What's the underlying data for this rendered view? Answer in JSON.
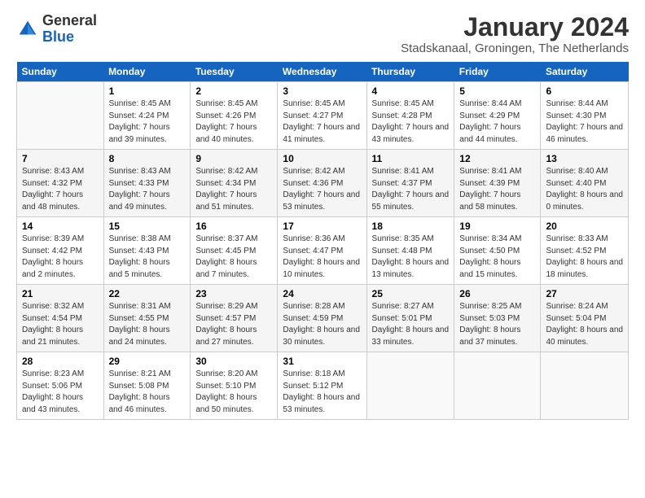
{
  "header": {
    "logo_general": "General",
    "logo_blue": "Blue",
    "month_title": "January 2024",
    "location": "Stadskanaal, Groningen, The Netherlands"
  },
  "days_of_week": [
    "Sunday",
    "Monday",
    "Tuesday",
    "Wednesday",
    "Thursday",
    "Friday",
    "Saturday"
  ],
  "weeks": [
    [
      {
        "day": "",
        "sunrise": "",
        "sunset": "",
        "daylight": ""
      },
      {
        "day": "1",
        "sunrise": "Sunrise: 8:45 AM",
        "sunset": "Sunset: 4:24 PM",
        "daylight": "Daylight: 7 hours and 39 minutes."
      },
      {
        "day": "2",
        "sunrise": "Sunrise: 8:45 AM",
        "sunset": "Sunset: 4:26 PM",
        "daylight": "Daylight: 7 hours and 40 minutes."
      },
      {
        "day": "3",
        "sunrise": "Sunrise: 8:45 AM",
        "sunset": "Sunset: 4:27 PM",
        "daylight": "Daylight: 7 hours and 41 minutes."
      },
      {
        "day": "4",
        "sunrise": "Sunrise: 8:45 AM",
        "sunset": "Sunset: 4:28 PM",
        "daylight": "Daylight: 7 hours and 43 minutes."
      },
      {
        "day": "5",
        "sunrise": "Sunrise: 8:44 AM",
        "sunset": "Sunset: 4:29 PM",
        "daylight": "Daylight: 7 hours and 44 minutes."
      },
      {
        "day": "6",
        "sunrise": "Sunrise: 8:44 AM",
        "sunset": "Sunset: 4:30 PM",
        "daylight": "Daylight: 7 hours and 46 minutes."
      }
    ],
    [
      {
        "day": "7",
        "sunrise": "Sunrise: 8:43 AM",
        "sunset": "Sunset: 4:32 PM",
        "daylight": "Daylight: 7 hours and 48 minutes."
      },
      {
        "day": "8",
        "sunrise": "Sunrise: 8:43 AM",
        "sunset": "Sunset: 4:33 PM",
        "daylight": "Daylight: 7 hours and 49 minutes."
      },
      {
        "day": "9",
        "sunrise": "Sunrise: 8:42 AM",
        "sunset": "Sunset: 4:34 PM",
        "daylight": "Daylight: 7 hours and 51 minutes."
      },
      {
        "day": "10",
        "sunrise": "Sunrise: 8:42 AM",
        "sunset": "Sunset: 4:36 PM",
        "daylight": "Daylight: 7 hours and 53 minutes."
      },
      {
        "day": "11",
        "sunrise": "Sunrise: 8:41 AM",
        "sunset": "Sunset: 4:37 PM",
        "daylight": "Daylight: 7 hours and 55 minutes."
      },
      {
        "day": "12",
        "sunrise": "Sunrise: 8:41 AM",
        "sunset": "Sunset: 4:39 PM",
        "daylight": "Daylight: 7 hours and 58 minutes."
      },
      {
        "day": "13",
        "sunrise": "Sunrise: 8:40 AM",
        "sunset": "Sunset: 4:40 PM",
        "daylight": "Daylight: 8 hours and 0 minutes."
      }
    ],
    [
      {
        "day": "14",
        "sunrise": "Sunrise: 8:39 AM",
        "sunset": "Sunset: 4:42 PM",
        "daylight": "Daylight: 8 hours and 2 minutes."
      },
      {
        "day": "15",
        "sunrise": "Sunrise: 8:38 AM",
        "sunset": "Sunset: 4:43 PM",
        "daylight": "Daylight: 8 hours and 5 minutes."
      },
      {
        "day": "16",
        "sunrise": "Sunrise: 8:37 AM",
        "sunset": "Sunset: 4:45 PM",
        "daylight": "Daylight: 8 hours and 7 minutes."
      },
      {
        "day": "17",
        "sunrise": "Sunrise: 8:36 AM",
        "sunset": "Sunset: 4:47 PM",
        "daylight": "Daylight: 8 hours and 10 minutes."
      },
      {
        "day": "18",
        "sunrise": "Sunrise: 8:35 AM",
        "sunset": "Sunset: 4:48 PM",
        "daylight": "Daylight: 8 hours and 13 minutes."
      },
      {
        "day": "19",
        "sunrise": "Sunrise: 8:34 AM",
        "sunset": "Sunset: 4:50 PM",
        "daylight": "Daylight: 8 hours and 15 minutes."
      },
      {
        "day": "20",
        "sunrise": "Sunrise: 8:33 AM",
        "sunset": "Sunset: 4:52 PM",
        "daylight": "Daylight: 8 hours and 18 minutes."
      }
    ],
    [
      {
        "day": "21",
        "sunrise": "Sunrise: 8:32 AM",
        "sunset": "Sunset: 4:54 PM",
        "daylight": "Daylight: 8 hours and 21 minutes."
      },
      {
        "day": "22",
        "sunrise": "Sunrise: 8:31 AM",
        "sunset": "Sunset: 4:55 PM",
        "daylight": "Daylight: 8 hours and 24 minutes."
      },
      {
        "day": "23",
        "sunrise": "Sunrise: 8:29 AM",
        "sunset": "Sunset: 4:57 PM",
        "daylight": "Daylight: 8 hours and 27 minutes."
      },
      {
        "day": "24",
        "sunrise": "Sunrise: 8:28 AM",
        "sunset": "Sunset: 4:59 PM",
        "daylight": "Daylight: 8 hours and 30 minutes."
      },
      {
        "day": "25",
        "sunrise": "Sunrise: 8:27 AM",
        "sunset": "Sunset: 5:01 PM",
        "daylight": "Daylight: 8 hours and 33 minutes."
      },
      {
        "day": "26",
        "sunrise": "Sunrise: 8:25 AM",
        "sunset": "Sunset: 5:03 PM",
        "daylight": "Daylight: 8 hours and 37 minutes."
      },
      {
        "day": "27",
        "sunrise": "Sunrise: 8:24 AM",
        "sunset": "Sunset: 5:04 PM",
        "daylight": "Daylight: 8 hours and 40 minutes."
      }
    ],
    [
      {
        "day": "28",
        "sunrise": "Sunrise: 8:23 AM",
        "sunset": "Sunset: 5:06 PM",
        "daylight": "Daylight: 8 hours and 43 minutes."
      },
      {
        "day": "29",
        "sunrise": "Sunrise: 8:21 AM",
        "sunset": "Sunset: 5:08 PM",
        "daylight": "Daylight: 8 hours and 46 minutes."
      },
      {
        "day": "30",
        "sunrise": "Sunrise: 8:20 AM",
        "sunset": "Sunset: 5:10 PM",
        "daylight": "Daylight: 8 hours and 50 minutes."
      },
      {
        "day": "31",
        "sunrise": "Sunrise: 8:18 AM",
        "sunset": "Sunset: 5:12 PM",
        "daylight": "Daylight: 8 hours and 53 minutes."
      },
      {
        "day": "",
        "sunrise": "",
        "sunset": "",
        "daylight": ""
      },
      {
        "day": "",
        "sunrise": "",
        "sunset": "",
        "daylight": ""
      },
      {
        "day": "",
        "sunrise": "",
        "sunset": "",
        "daylight": ""
      }
    ]
  ]
}
